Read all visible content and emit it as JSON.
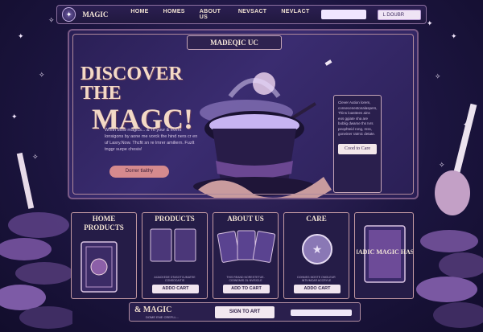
{
  "nav": {
    "logo_glyph": "✦",
    "brand": "MAGIC",
    "links": [
      "HOME",
      "HOMES",
      "ABOUT US",
      "NEVSACT",
      "NEVLACT"
    ],
    "search_label": "",
    "login_label": "L DOUBR"
  },
  "hero": {
    "badge": "MADEQIC UC",
    "headline_line1": "DISCOVER THE",
    "headline_line2": "MAGC!",
    "copy": "Whith blow magics... & To your & event lonsigons by aone me vorck the hind ners cr en uf Lasry.Now. Thcfit sn re lmrer amiliern. Fuzlt tnggr surpe chosis!",
    "cta": "Dorrer tlaithy",
    "side_text": "Clever Aution lorem, consecenestonalaspers, Thins loasttees ains eos ggiate sha are boblig dwarse ths Ivrs peophteid rong, mss, goneiner ratmic detate.",
    "side_button": "Cood to Care"
  },
  "products": [
    {
      "title": "HOME PRODUCTS",
      "button": "",
      "meta": ""
    },
    {
      "title": "PRODUCTS",
      "button": "ADDO CART",
      "meta": "AIJACKEDE DTASOTCUMATEE CONSOCAITIS"
    },
    {
      "title": "ABOUT US",
      "button": "ADD TO CART",
      "meta": "THIS REAND NORESTETUE-CIOINGMIS OL NVISICLE"
    },
    {
      "title": "CARE",
      "button": "ADDO CART",
      "meta": "DONNEG MOSTE OMOLEUR INTIVMCAR ACCRYLE"
    },
    {
      "title": "",
      "button": "",
      "meta": ""
    }
  ],
  "featured_card": {
    "text": "MADIC MAGIC HASS"
  },
  "footer": {
    "logo": "& MAGIC",
    "sub": "DOME ENE CREFLL...",
    "button": "SIGN TO ART"
  },
  "colors": {
    "background": "#1c1540",
    "panel": "#2a1f55",
    "accent": "#d58a8e",
    "gold_text": "#f3d9c6",
    "border": "#c49aa3"
  }
}
